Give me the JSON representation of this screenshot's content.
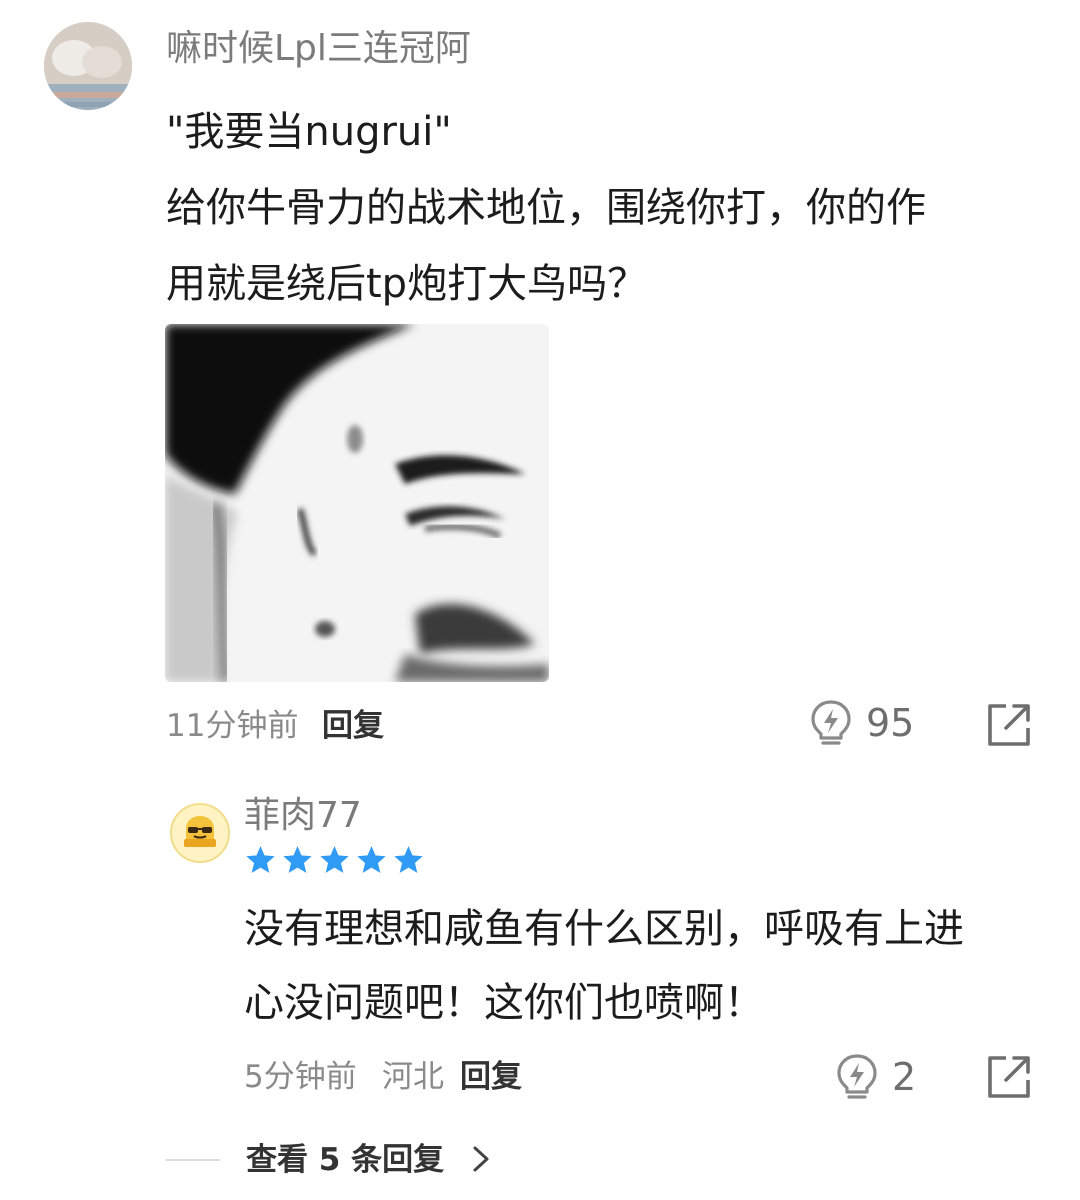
{
  "comment": {
    "username": "嘛时候Lpl三连冠阿",
    "lines": [
      "\"我要当nugrui\"",
      "给你牛骨力的战术地位，围绕你打，你的作",
      "用就是绕后tp炮打大鸟吗？"
    ],
    "time": "11分钟前",
    "reply_label": "回复",
    "like_count": "95"
  },
  "reply": {
    "username": "菲肉77",
    "stars": 5,
    "star_color": "#2f9bf5",
    "lines": [
      "没有理想和咸鱼有什么区别，呼吸有上进",
      "心没问题吧！这你们也喷啊！"
    ],
    "time": "5分钟前",
    "location": "河北",
    "reply_label": "回复",
    "like_count": "2"
  },
  "view_replies": {
    "label": "查看 5 条回复"
  },
  "icons": {
    "like": "lightbulb-icon",
    "share": "share-icon",
    "more": "chevron-right-icon"
  }
}
